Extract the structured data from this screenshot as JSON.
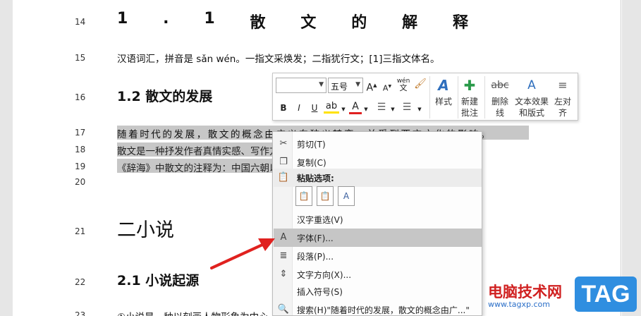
{
  "document": {
    "lines": [
      {
        "num": "14",
        "text_parts": [
          "1",
          ".",
          "1",
          "散",
          "文",
          "的",
          "解",
          "释"
        ]
      },
      {
        "num": "15",
        "text": "汉语词汇，拼音是 sǎn wén。一指文采焕发；二指犹行文；[1]三指文体名。"
      },
      {
        "num": "16",
        "text": "1.2 散文的发展"
      },
      {
        "num": "17",
        "text": "随着时代的发展，散文的概念由广义向狭义转变，并受到西方文化的影响。"
      },
      {
        "num": "18",
        "text": "散文是一种抒发作者真情实感、写作方式灵活的记叙类文学体裁。散文"
      },
      {
        "num": "19",
        "text": "《辞海》中散文的注释为：中国六朝以来，为区别韵文与骈文，把凡不押韵、不重排"
      },
      {
        "num": "20",
        "text": ""
      },
      {
        "num": "21",
        "text": "二小说"
      },
      {
        "num": "22",
        "text": "2.1 小说起源"
      },
      {
        "num": "23",
        "text": "①小说是一种以刻画人物形象为中心，通过完整的故事情节和环境描写来反映社会"
      }
    ]
  },
  "mini_toolbar": {
    "font_name": "",
    "font_size": "五号",
    "grow_font": "A",
    "shrink_font": "A",
    "phonetic": "wén",
    "bold": "B",
    "italic": "I",
    "underline": "U",
    "styles_label": "样式",
    "new_comment_label": "新建\n批注",
    "delete_label": "删除\n线",
    "text_effect_label": "文本效果\n和版式",
    "align_left_label": "左对\n齐",
    "delete_icon_text": "abc"
  },
  "context_menu": {
    "items": [
      {
        "label": "剪切(T)",
        "icon": "scissors-icon"
      },
      {
        "label": "复制(C)",
        "icon": "copy-icon"
      },
      {
        "label": "粘贴选项:",
        "icon": "paste-icon"
      },
      {
        "label": "汉字重选(V)",
        "icon": ""
      },
      {
        "label": "字体(F)...",
        "icon": "font-icon"
      },
      {
        "label": "段落(P)...",
        "icon": "paragraph-icon"
      },
      {
        "label": "文字方向(X)...",
        "icon": "text-direction-icon"
      },
      {
        "label": "插入符号(S)",
        "icon": ""
      },
      {
        "label": "搜索(H)\"随着时代的发展，散文的概念由广...\"",
        "icon": "search-icon"
      }
    ],
    "paste_option_glyph": "A",
    "font_icon_glyph": "A"
  },
  "watermark": {
    "site_name": "电脑技术网",
    "url": "www.tagxp.com",
    "badge": "TAG"
  },
  "colors": {
    "selection": "#c7c7c7",
    "menu_highlight": "#c6c6c6",
    "arrow": "#e0211f",
    "accent_blue": "#2f6fbd"
  }
}
